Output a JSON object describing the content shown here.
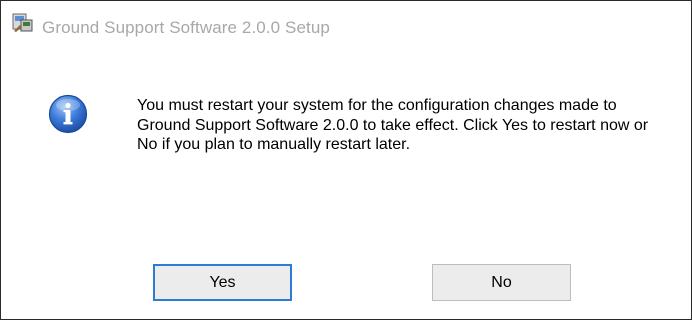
{
  "window": {
    "title": "Ground Support Software 2.0.0 Setup",
    "app_icon": "installer-icon"
  },
  "dialog": {
    "icon": "info-icon",
    "message": "You must restart your system for the configuration changes made to Ground Support Software 2.0.0 to take effect. Click Yes to restart now or No if you plan to manually restart later."
  },
  "buttons": {
    "yes_label": "Yes",
    "no_label": "No"
  },
  "colors": {
    "title_text": "#a8a8a8",
    "default_button_border": "#2e7bd6",
    "info_icon_blue": "#2f6fd0"
  }
}
